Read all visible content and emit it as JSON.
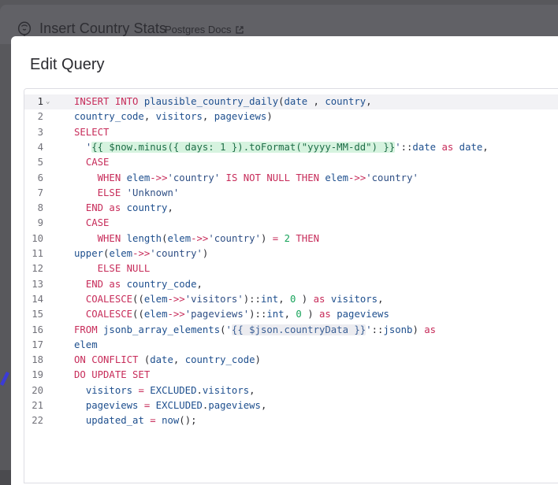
{
  "background": {
    "workflow_title": "Insert Country Stats",
    "docs_link": "Postgres Docs"
  },
  "modal": {
    "title": "Edit Query"
  },
  "editor": {
    "active_line": 1,
    "lines": [
      {
        "n": "1",
        "tokens": [
          [
            "kw",
            "INSERT INTO "
          ],
          [
            "id",
            "plausible_country_daily"
          ],
          [
            "",
            "("
          ],
          [
            "id",
            "date"
          ],
          [
            "",
            " , "
          ],
          [
            "id",
            "country"
          ],
          [
            "",
            ","
          ]
        ]
      },
      {
        "n": "2",
        "tokens": [
          [
            "id",
            "country_code"
          ],
          [
            "",
            ", "
          ],
          [
            "id",
            "visitors"
          ],
          [
            "",
            ", "
          ],
          [
            "id",
            "pageviews"
          ],
          [
            "",
            ")"
          ]
        ]
      },
      {
        "n": "3",
        "tokens": [
          [
            "kw",
            "SELECT"
          ]
        ]
      },
      {
        "n": "4",
        "tokens": [
          [
            "",
            "  "
          ],
          [
            "str",
            "'"
          ],
          [
            "expr",
            "{{ $now.minus({ days: 1 }).toFormat(\"yyyy-MM-dd\") }}"
          ],
          [
            "str",
            "'"
          ],
          [
            "",
            "::"
          ],
          [
            "id",
            "date"
          ],
          [
            "",
            " "
          ],
          [
            "kw",
            "as "
          ],
          [
            "id",
            "date"
          ],
          [
            "",
            ","
          ]
        ]
      },
      {
        "n": "5",
        "tokens": [
          [
            "",
            "  "
          ],
          [
            "kw",
            "CASE"
          ]
        ]
      },
      {
        "n": "6",
        "tokens": [
          [
            "",
            "    "
          ],
          [
            "kw",
            "WHEN "
          ],
          [
            "id",
            "elem"
          ],
          [
            "kw",
            "->>"
          ],
          [
            "str",
            "'country'"
          ],
          [
            "kw",
            " IS NOT NULL THEN "
          ],
          [
            "id",
            "elem"
          ],
          [
            "kw",
            "->>"
          ],
          [
            "str",
            "'country'"
          ]
        ]
      },
      {
        "n": "7",
        "tokens": [
          [
            "",
            "    "
          ],
          [
            "kw",
            "ELSE "
          ],
          [
            "str",
            "'Unknown'"
          ]
        ]
      },
      {
        "n": "8",
        "tokens": [
          [
            "",
            "  "
          ],
          [
            "kw",
            "END as "
          ],
          [
            "id",
            "country"
          ],
          [
            "",
            ","
          ]
        ]
      },
      {
        "n": "9",
        "tokens": [
          [
            "",
            "  "
          ],
          [
            "kw",
            "CASE"
          ]
        ]
      },
      {
        "n": "10",
        "tokens": [
          [
            "",
            "    "
          ],
          [
            "kw",
            "WHEN "
          ],
          [
            "id",
            "length"
          ],
          [
            "",
            "("
          ],
          [
            "id",
            "elem"
          ],
          [
            "kw",
            "->>"
          ],
          [
            "str",
            "'country'"
          ],
          [
            "",
            ") "
          ],
          [
            "kw",
            "= "
          ],
          [
            "num",
            "2"
          ],
          [
            "kw",
            " THEN"
          ]
        ]
      },
      {
        "n": "11",
        "tokens": [
          [
            "id",
            "upper"
          ],
          [
            "",
            "("
          ],
          [
            "id",
            "elem"
          ],
          [
            "kw",
            "->>"
          ],
          [
            "str",
            "'country'"
          ],
          [
            "",
            ")"
          ]
        ]
      },
      {
        "n": "12",
        "tokens": [
          [
            "",
            "    "
          ],
          [
            "kw",
            "ELSE NULL"
          ]
        ]
      },
      {
        "n": "13",
        "tokens": [
          [
            "",
            "  "
          ],
          [
            "kw",
            "END as "
          ],
          [
            "id",
            "country_code"
          ],
          [
            "",
            ","
          ]
        ]
      },
      {
        "n": "14",
        "tokens": [
          [
            "",
            "  "
          ],
          [
            "kw",
            "COALESCE"
          ],
          [
            "",
            "(("
          ],
          [
            "id",
            "elem"
          ],
          [
            "kw",
            "->>"
          ],
          [
            "str",
            "'visitors'"
          ],
          [
            "",
            ")::"
          ],
          [
            "id",
            "int"
          ],
          [
            "",
            ", "
          ],
          [
            "num",
            "0"
          ],
          [
            "",
            " ) "
          ],
          [
            "kw",
            "as "
          ],
          [
            "id",
            "visitors"
          ],
          [
            "",
            ","
          ]
        ]
      },
      {
        "n": "15",
        "tokens": [
          [
            "",
            "  "
          ],
          [
            "kw",
            "COALESCE"
          ],
          [
            "",
            "(("
          ],
          [
            "id",
            "elem"
          ],
          [
            "kw",
            "->>"
          ],
          [
            "str",
            "'pageviews'"
          ],
          [
            "",
            ")::"
          ],
          [
            "id",
            "int"
          ],
          [
            "",
            ", "
          ],
          [
            "num",
            "0"
          ],
          [
            "",
            " ) "
          ],
          [
            "kw",
            "as "
          ],
          [
            "id",
            "pageviews"
          ]
        ]
      },
      {
        "n": "16",
        "tokens": [
          [
            "kw",
            "FROM "
          ],
          [
            "id",
            "jsonb_array_elements"
          ],
          [
            "",
            "("
          ],
          [
            "str",
            "'"
          ],
          [
            "expr2",
            "{{ $json.countryData }}"
          ],
          [
            "str",
            "'"
          ],
          [
            "",
            "::"
          ],
          [
            "id",
            "jsonb"
          ],
          [
            "",
            ") "
          ],
          [
            "kw",
            "as"
          ]
        ]
      },
      {
        "n": "17",
        "tokens": [
          [
            "id",
            "elem"
          ]
        ]
      },
      {
        "n": "18",
        "tokens": [
          [
            "kw",
            "ON CONFLICT "
          ],
          [
            "",
            "("
          ],
          [
            "id",
            "date"
          ],
          [
            "",
            ", "
          ],
          [
            "id",
            "country_code"
          ],
          [
            "",
            ")"
          ]
        ]
      },
      {
        "n": "19",
        "tokens": [
          [
            "kw",
            "DO UPDATE SET"
          ]
        ]
      },
      {
        "n": "20",
        "tokens": [
          [
            "",
            "  "
          ],
          [
            "id",
            "visitors"
          ],
          [
            "kw",
            " = "
          ],
          [
            "id",
            "EXCLUDED"
          ],
          [
            "",
            "."
          ],
          [
            "id",
            "visitors"
          ],
          [
            "",
            ","
          ]
        ]
      },
      {
        "n": "21",
        "tokens": [
          [
            "",
            "  "
          ],
          [
            "id",
            "pageviews"
          ],
          [
            "kw",
            " = "
          ],
          [
            "id",
            "EXCLUDED"
          ],
          [
            "",
            "."
          ],
          [
            "id",
            "pageviews"
          ],
          [
            "",
            ","
          ]
        ]
      },
      {
        "n": "22",
        "tokens": [
          [
            "",
            "  "
          ],
          [
            "id",
            "updated_at"
          ],
          [
            "kw",
            " = "
          ],
          [
            "id",
            "now"
          ],
          [
            "",
            "();"
          ]
        ]
      }
    ]
  }
}
